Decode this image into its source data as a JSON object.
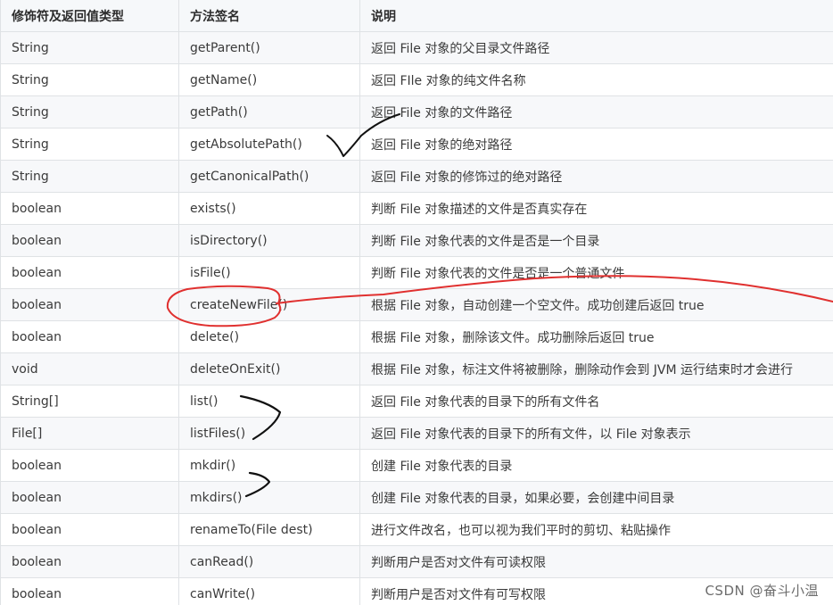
{
  "table": {
    "headers": [
      "修饰符及返回值类型",
      "方法签名",
      "说明"
    ],
    "rows": [
      {
        "type": "String",
        "method": "getParent()",
        "desc": "返回 File 对象的父目录文件路径"
      },
      {
        "type": "String",
        "method": "getName()",
        "desc": "返回 FIle 对象的纯文件名称"
      },
      {
        "type": "String",
        "method": "getPath()",
        "desc": "返回 File 对象的文件路径"
      },
      {
        "type": "String",
        "method": "getAbsolutePath()",
        "desc": "返回 File 对象的绝对路径"
      },
      {
        "type": "String",
        "method": "getCanonicalPath()",
        "desc": "返回 File 对象的修饰过的绝对路径"
      },
      {
        "type": "boolean",
        "method": "exists()",
        "desc": "判断 File 对象描述的文件是否真实存在"
      },
      {
        "type": "boolean",
        "method": "isDirectory()",
        "desc": "判断 File 对象代表的文件是否是一个目录"
      },
      {
        "type": "boolean",
        "method": "isFile()",
        "desc": "判断 File 对象代表的文件是否是一个普通文件"
      },
      {
        "type": "boolean",
        "method": "createNewFile()",
        "desc": "根据 File 对象，自动创建一个空文件。成功创建后返回 true"
      },
      {
        "type": "boolean",
        "method": "delete()",
        "desc": "根据 File 对象，删除该文件。成功删除后返回 true"
      },
      {
        "type": "void",
        "method": "deleteOnExit()",
        "desc": "根据 File 对象，标注文件将被删除，删除动作会到 JVM 运行结束时才会进行"
      },
      {
        "type": "String[]",
        "method": "list()",
        "desc": "返回 File 对象代表的目录下的所有文件名"
      },
      {
        "type": "File[]",
        "method": "listFiles()",
        "desc": "返回 File 对象代表的目录下的所有文件，以 File 对象表示"
      },
      {
        "type": "boolean",
        "method": "mkdir()",
        "desc": "创建 File 对象代表的目录"
      },
      {
        "type": "boolean",
        "method": "mkdirs()",
        "desc": "创建 File 对象代表的目录，如果必要，会创建中间目录"
      },
      {
        "type": "boolean",
        "method": "renameTo(File dest)",
        "desc": "进行文件改名，也可以视为我们平时的剪切、粘贴操作"
      },
      {
        "type": "boolean",
        "method": "canRead()",
        "desc": "判断用户是否对文件有可读权限"
      },
      {
        "type": "boolean",
        "method": "canWrite()",
        "desc": "判断用户是否对文件有可写权限"
      }
    ]
  },
  "watermark": "CSDN @奋斗小温",
  "colors": {
    "annotation_red": "#e0302f",
    "annotation_black": "#111111",
    "header_bg": "#f6f8fa",
    "stripe_bg": "#f7f8fa",
    "border": "#dfe2e5"
  }
}
